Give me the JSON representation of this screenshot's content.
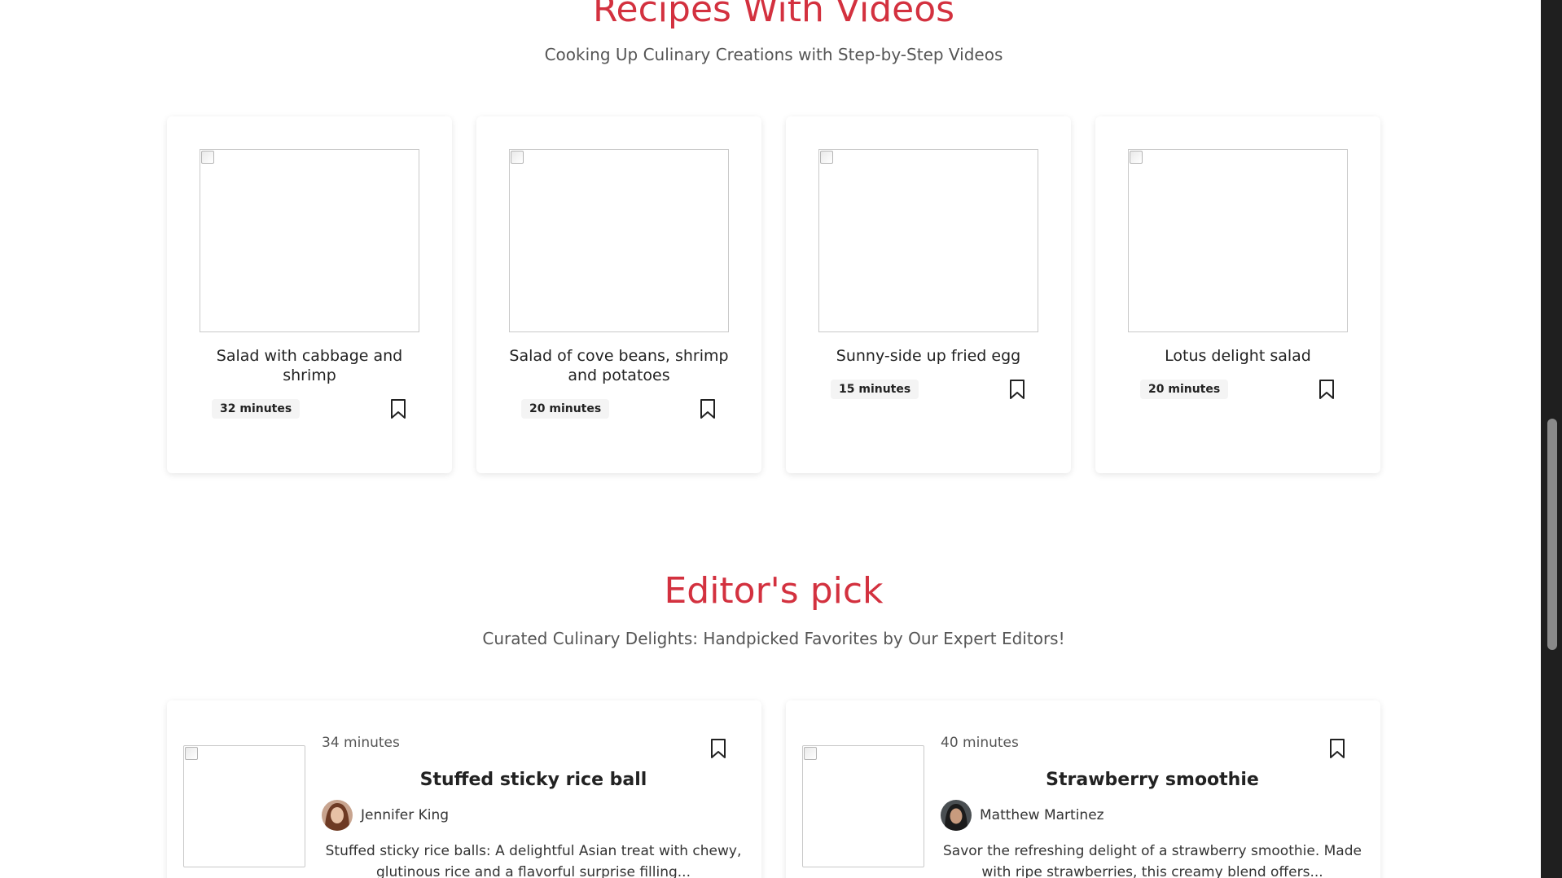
{
  "videos_section": {
    "title": "Recipes With Videos",
    "subtitle": "Cooking Up Culinary Creations with Step-by-Step Videos",
    "cards": [
      {
        "title": "Salad with cabbage and shrimp",
        "time": "32 minutes"
      },
      {
        "title": "Salad of cove beans, shrimp and potatoes",
        "time": "20 minutes"
      },
      {
        "title": "Sunny-side up fried egg",
        "time": "15 minutes"
      },
      {
        "title": "Lotus delight salad",
        "time": "20 minutes"
      }
    ]
  },
  "editors_section": {
    "title": "Editor's pick",
    "subtitle": "Curated Culinary Delights: Handpicked Favorites by Our Expert Editors!",
    "cards": [
      {
        "time": "34 minutes",
        "title": "Stuffed sticky rice ball",
        "author": "Jennifer King",
        "description": "Stuffed sticky rice balls: A delightful Asian treat with chewy, glutinous rice and a flavorful surprise filling..."
      },
      {
        "time": "40 minutes",
        "title": "Strawberry smoothie",
        "author": "Matthew Martinez",
        "description": "Savor the refreshing delight of a strawberry smoothie. Made with ripe strawberries, this creamy blend offers..."
      }
    ]
  },
  "colors": {
    "accent": "#d3313f",
    "card_bg": "#ffffff",
    "badge_bg": "#f4f4f4"
  },
  "icons": {
    "bookmark": "bookmark-icon",
    "broken_image": "broken-image-icon"
  }
}
